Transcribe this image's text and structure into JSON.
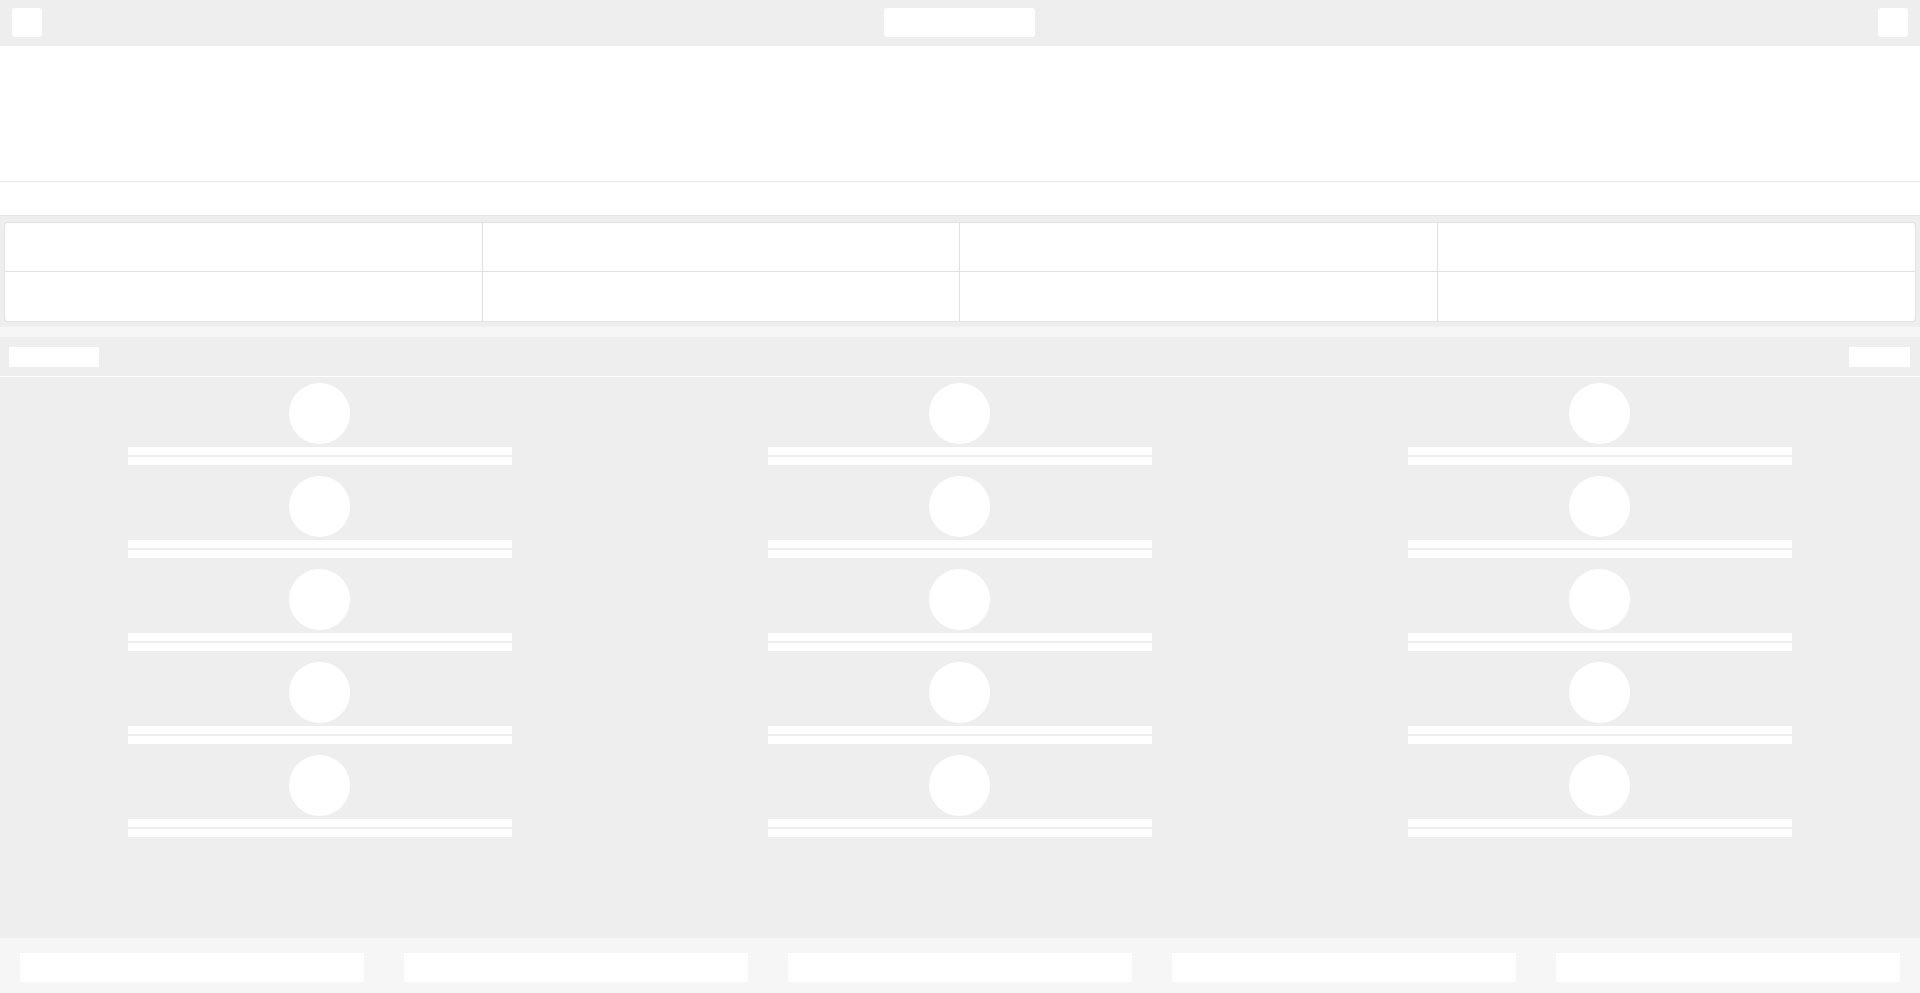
{
  "app": {
    "state": "loading",
    "placeholder_color": "#ffffff",
    "background_color": "#eeeeee"
  },
  "topbar": {
    "left_button": {
      "label": "",
      "icon": "menu-icon"
    },
    "title": "",
    "right_button": {
      "label": "",
      "icon": "more-icon"
    }
  },
  "hero": {
    "title": "",
    "subtitle": ""
  },
  "subbar": {
    "text": ""
  },
  "stats": [
    {
      "label": "",
      "value": ""
    },
    {
      "label": "",
      "value": ""
    },
    {
      "label": "",
      "value": ""
    },
    {
      "label": "",
      "value": ""
    },
    {
      "label": "",
      "value": ""
    },
    {
      "label": "",
      "value": ""
    },
    {
      "label": "",
      "value": ""
    },
    {
      "label": "",
      "value": ""
    }
  ],
  "section": {
    "title": "",
    "action_label": ""
  },
  "columns": [
    {
      "items": [
        {
          "title": "",
          "subtitle": ""
        },
        {
          "title": "",
          "subtitle": ""
        },
        {
          "title": "",
          "subtitle": ""
        },
        {
          "title": "",
          "subtitle": ""
        },
        {
          "title": "",
          "subtitle": ""
        }
      ]
    },
    {
      "items": [
        {
          "title": "",
          "subtitle": ""
        },
        {
          "title": "",
          "subtitle": ""
        },
        {
          "title": "",
          "subtitle": ""
        },
        {
          "title": "",
          "subtitle": ""
        },
        {
          "title": "",
          "subtitle": ""
        }
      ]
    },
    {
      "items": [
        {
          "title": "",
          "subtitle": ""
        },
        {
          "title": "",
          "subtitle": ""
        },
        {
          "title": "",
          "subtitle": ""
        },
        {
          "title": "",
          "subtitle": ""
        },
        {
          "title": "",
          "subtitle": ""
        }
      ]
    }
  ],
  "footer": {
    "tabs": [
      {
        "label": ""
      },
      {
        "label": ""
      },
      {
        "label": ""
      },
      {
        "label": ""
      },
      {
        "label": ""
      }
    ]
  }
}
